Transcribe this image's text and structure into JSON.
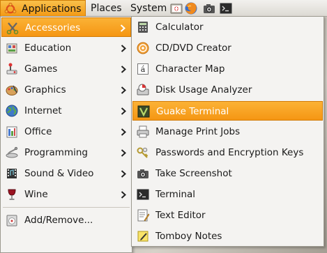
{
  "top_panel": {
    "applications": "Applications",
    "places": "Places",
    "system": "System",
    "launchers": [
      "help-icon",
      "firefox-icon",
      "screenshot-icon",
      "terminal-icon"
    ]
  },
  "main_menu": {
    "items": [
      {
        "label": "Accessories",
        "icon": "accessories-icon",
        "active": true
      },
      {
        "label": "Education",
        "icon": "education-icon"
      },
      {
        "label": "Games",
        "icon": "games-icon"
      },
      {
        "label": "Graphics",
        "icon": "graphics-icon"
      },
      {
        "label": "Internet",
        "icon": "internet-icon"
      },
      {
        "label": "Office",
        "icon": "office-icon"
      },
      {
        "label": "Programming",
        "icon": "programming-icon"
      },
      {
        "label": "Sound & Video",
        "icon": "sound-video-icon"
      },
      {
        "label": "Wine",
        "icon": "wine-icon"
      }
    ],
    "add_remove": "Add/Remove..."
  },
  "sub_menu": {
    "items": [
      {
        "label": "Calculator",
        "icon": "calculator-icon"
      },
      {
        "label": "CD/DVD Creator",
        "icon": "cd-dvd-icon"
      },
      {
        "label": "Character Map",
        "icon": "character-map-icon"
      },
      {
        "label": "Disk Usage Analyzer",
        "icon": "disk-usage-icon"
      },
      {
        "label": "Guake Terminal",
        "icon": "guake-icon",
        "active": true
      },
      {
        "label": "Manage Print Jobs",
        "icon": "printer-icon"
      },
      {
        "label": "Passwords and Encryption Keys",
        "icon": "keys-icon"
      },
      {
        "label": "Take Screenshot",
        "icon": "camera-icon"
      },
      {
        "label": "Terminal",
        "icon": "terminal-icon"
      },
      {
        "label": "Text Editor",
        "icon": "text-editor-icon"
      },
      {
        "label": "Tomboy Notes",
        "icon": "tomboy-icon"
      }
    ]
  },
  "colors": {
    "highlight": "#f59613",
    "highlight_border": "#d27c07",
    "menu_bg": "#f4f3f1"
  }
}
